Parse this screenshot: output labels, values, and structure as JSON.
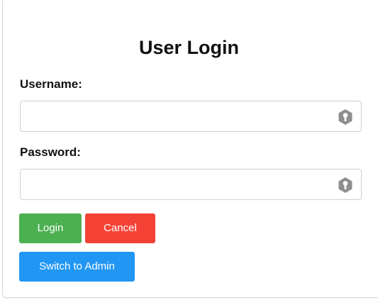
{
  "login_form": {
    "title": "User Login",
    "username": {
      "label": "Username:",
      "value": "",
      "placeholder": "",
      "icon": "password-manager-key-icon"
    },
    "password": {
      "label": "Password:",
      "value": "",
      "placeholder": "",
      "icon": "password-manager-key-icon"
    },
    "buttons": {
      "login": {
        "label": "Login",
        "color": "#4caf50"
      },
      "cancel": {
        "label": "Cancel",
        "color": "#f44336"
      },
      "switch_admin": {
        "label": "Switch to Admin",
        "color": "#2196f3"
      }
    }
  }
}
